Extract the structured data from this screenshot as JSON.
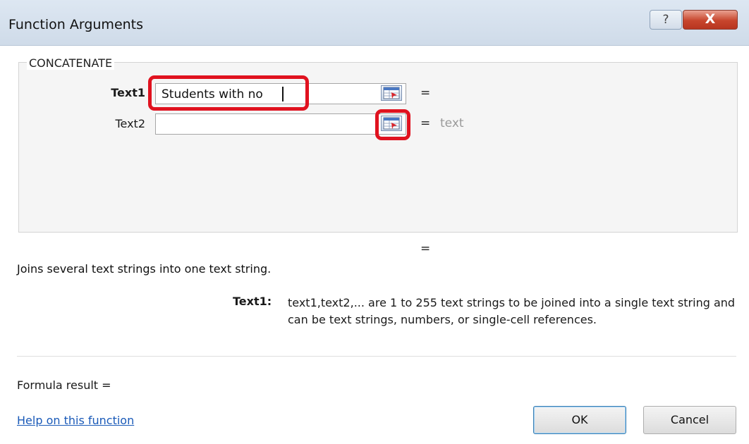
{
  "window": {
    "title": "Function Arguments",
    "help_glyph": "?",
    "close_glyph": "X"
  },
  "function": {
    "name": "CONCATENATE",
    "args": [
      {
        "label": "Text1",
        "value": "Students with no",
        "equals": "=",
        "result": ""
      },
      {
        "label": "Text2",
        "value": "",
        "equals": "=",
        "result": "text"
      }
    ]
  },
  "preview_equals": "=",
  "description": "Joins several text strings into one text string.",
  "param_help": {
    "name": "Text1:",
    "text": "text1,text2,... are 1 to 255 text strings to be joined into a single text string and can be text strings, numbers, or single-cell references."
  },
  "formula_result": "Formula result =",
  "help_link": "Help on this function",
  "buttons": {
    "ok": "OK",
    "cancel": "Cancel"
  },
  "colors": {
    "highlight": "#e0121f",
    "link": "#1a5ab8",
    "close": "#c7452c"
  },
  "icons": [
    "help-icon",
    "close-icon",
    "range-selector-icon"
  ]
}
